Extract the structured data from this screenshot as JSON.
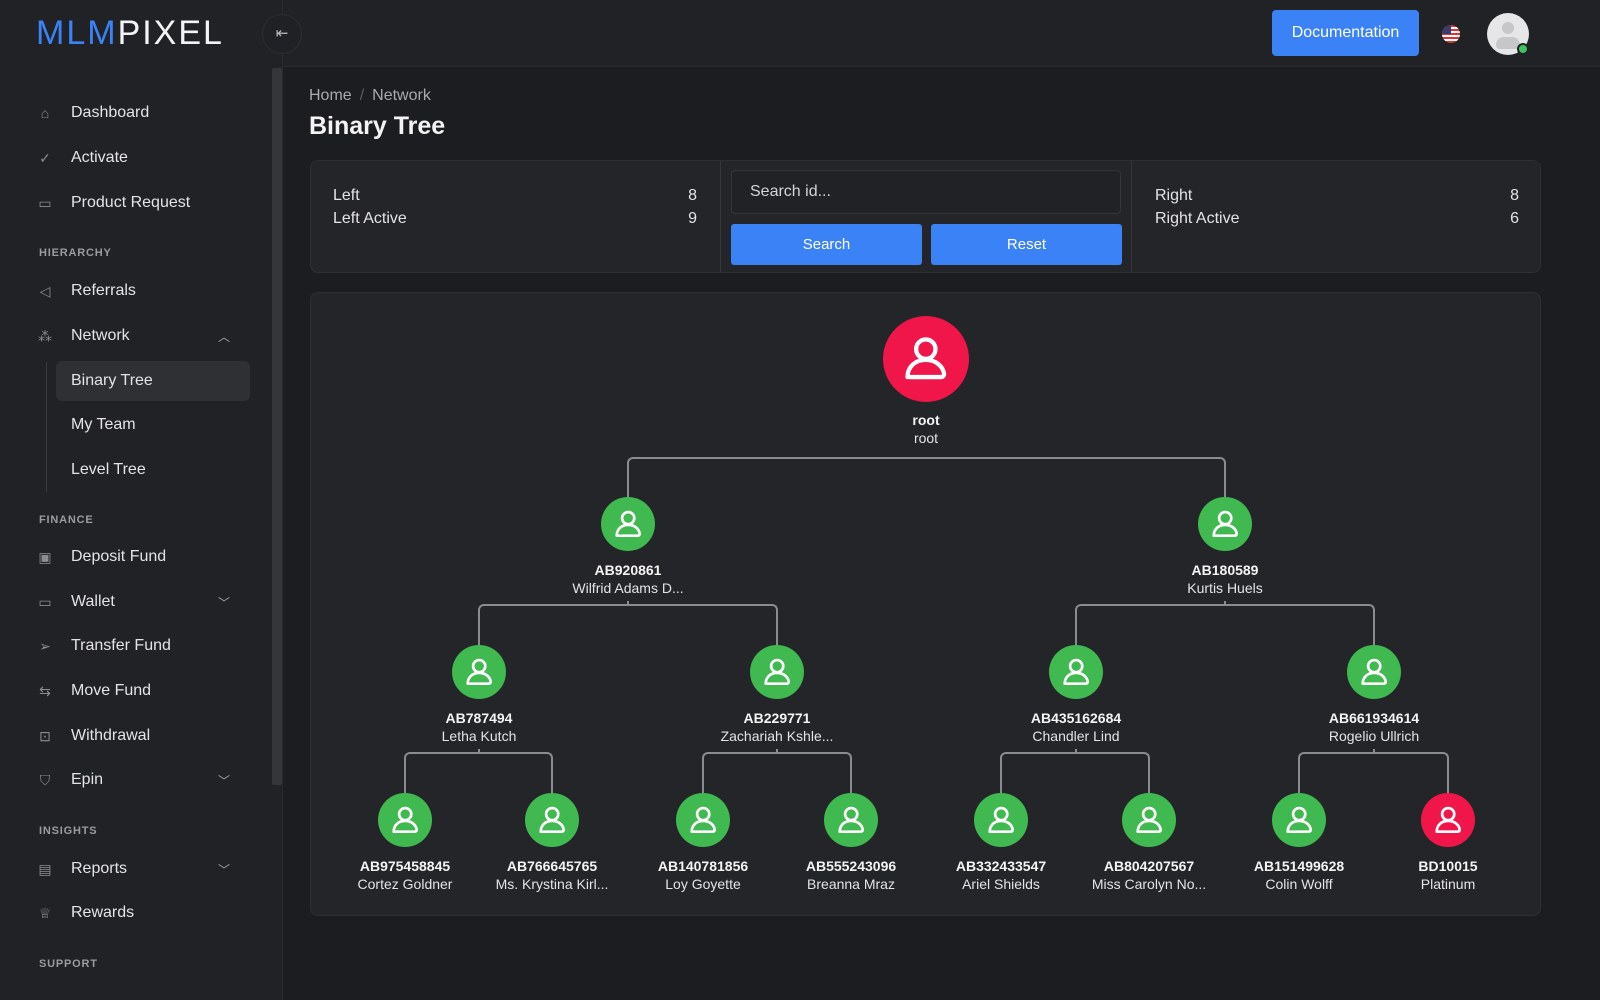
{
  "brand": {
    "part1": "MLM",
    "part2": "PIXEL"
  },
  "topbar": {
    "documentation": "Documentation",
    "language": "en-US"
  },
  "sidebar": {
    "items": [
      {
        "label": "Dashboard",
        "icon": "home-icon"
      },
      {
        "label": "Activate",
        "icon": "check-circle-icon"
      },
      {
        "label": "Product Request",
        "icon": "box-icon"
      }
    ],
    "hierarchy_title": "HIERARCHY",
    "hierarchy": [
      {
        "label": "Referrals",
        "icon": "megaphone-icon"
      },
      {
        "label": "Network",
        "icon": "network-icon",
        "expanded": true
      }
    ],
    "network_sub": [
      "Binary Tree",
      "My Team",
      "Level Tree"
    ],
    "active": "Binary Tree",
    "finance_title": "FINANCE",
    "finance": [
      {
        "label": "Deposit Fund"
      },
      {
        "label": "Wallet"
      },
      {
        "label": "Transfer Fund"
      },
      {
        "label": "Move Fund"
      },
      {
        "label": "Withdrawal"
      },
      {
        "label": "Epin"
      }
    ],
    "insights_title": "INSIGHTS",
    "insights": [
      {
        "label": "Reports"
      },
      {
        "label": "Rewards"
      }
    ],
    "support_title": "SUPPORT"
  },
  "breadcrumb": {
    "home": "Home",
    "current": "Network"
  },
  "page_title": "Binary Tree",
  "stats": {
    "left_label": "Left",
    "left": "8",
    "left_active_label": "Left Active",
    "left_active": "9",
    "right_label": "Right",
    "right": "8",
    "right_active_label": "Right Active",
    "right_active": "6",
    "search_placeholder": "Search id...",
    "search": "Search",
    "reset": "Reset"
  },
  "colors": {
    "active": "#3fb950",
    "inactive": "#f0164a",
    "accent": "#3b82f6"
  },
  "tree": [
    {
      "id": "root",
      "name": "root",
      "status": "inactive"
    },
    {
      "id": "AB920861",
      "name": "Wilfrid Adams D...",
      "status": "active"
    },
    {
      "id": "AB180589",
      "name": "Kurtis Huels",
      "status": "active"
    },
    {
      "id": "AB787494",
      "name": "Letha Kutch",
      "status": "active"
    },
    {
      "id": "AB229771",
      "name": "Zachariah Kshle...",
      "status": "active"
    },
    {
      "id": "AB435162684",
      "name": "Chandler Lind",
      "status": "active"
    },
    {
      "id": "AB661934614",
      "name": "Rogelio Ullrich",
      "status": "active"
    },
    {
      "id": "AB975458845",
      "name": "Cortez Goldner",
      "status": "active"
    },
    {
      "id": "AB766645765",
      "name": "Ms. Krystina Kirl...",
      "status": "active"
    },
    {
      "id": "AB140781856",
      "name": "Loy Goyette",
      "status": "active"
    },
    {
      "id": "AB555243096",
      "name": "Breanna Mraz",
      "status": "active"
    },
    {
      "id": "AB332433547",
      "name": "Ariel Shields",
      "status": "active"
    },
    {
      "id": "AB804207567",
      "name": "Miss Carolyn No...",
      "status": "active"
    },
    {
      "id": "AB151499628",
      "name": "Colin Wolff",
      "status": "active"
    },
    {
      "id": "BD10015",
      "name": "Platinum",
      "status": "inactive"
    }
  ]
}
